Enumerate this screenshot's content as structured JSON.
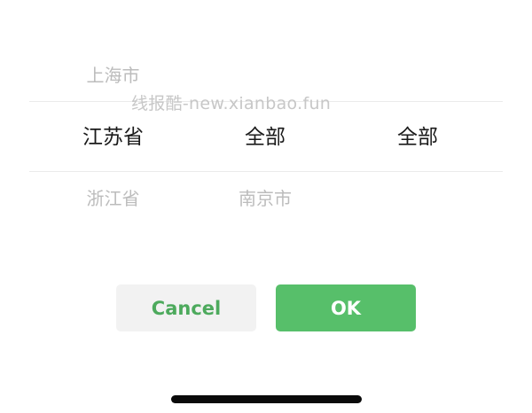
{
  "picker": {
    "province": {
      "above_faint": "",
      "previous": "上海市",
      "selected": "江苏省",
      "next": "浙江省",
      "below_faint": ""
    },
    "city": {
      "selected": "全部",
      "next": "南京市",
      "below_faint": ""
    },
    "district": {
      "selected": "全部"
    }
  },
  "watermark": "线报酷-new.xianbao.fun",
  "buttons": {
    "cancel_label": "Cancel",
    "ok_label": "OK"
  },
  "colors": {
    "accent": "#57bf6a",
    "cancel_text": "#4daa5d",
    "cancel_bg": "#f2f2f2"
  }
}
